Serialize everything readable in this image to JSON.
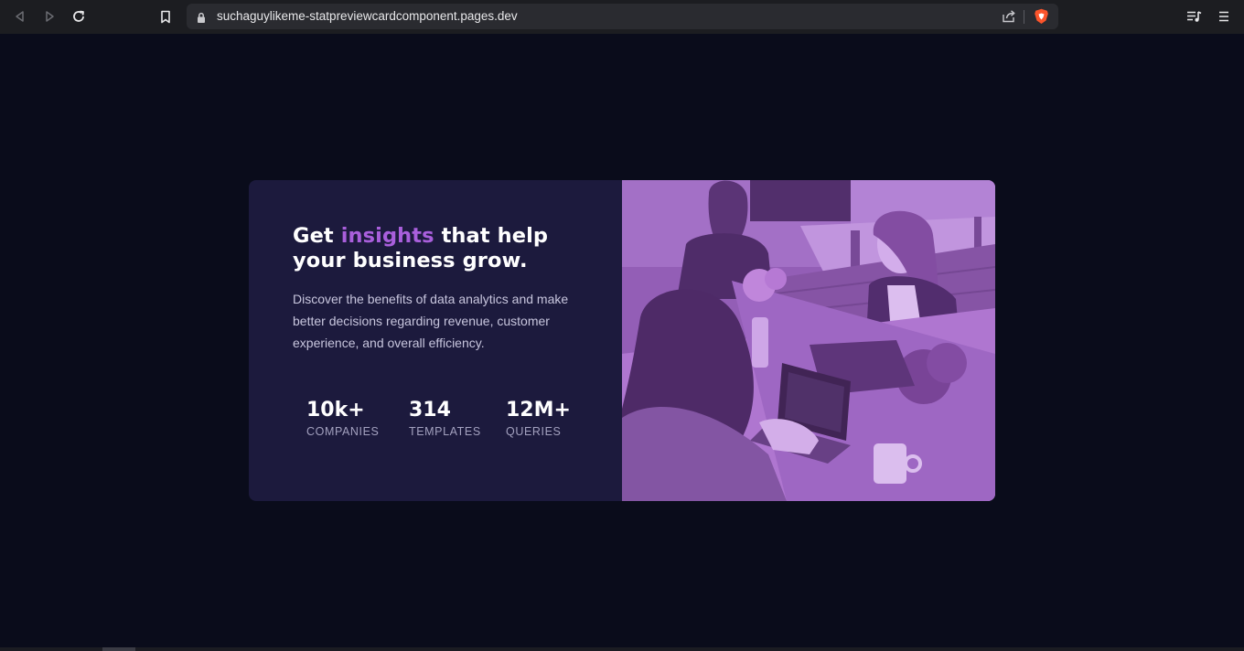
{
  "browser": {
    "url": "suchaguylikeme-statpreviewcardcomponent.pages.dev",
    "icons": {
      "back": "back-arrow-icon",
      "forward": "forward-arrow-icon",
      "reload": "reload-icon",
      "bookmark": "bookmark-icon",
      "lock": "lock-icon",
      "share": "share-icon",
      "brave": "brave-shield-icon",
      "playlist": "playlist-icon",
      "menu": "menu-icon"
    }
  },
  "card": {
    "headline_prefix": "Get ",
    "headline_accent": "insights",
    "headline_suffix": " that help your business grow.",
    "description": "Discover the benefits of data analytics and make better decisions regarding revenue, customer experience, and overall efficiency.",
    "stats": [
      {
        "value": "10k+",
        "label": "COMPANIES"
      },
      {
        "value": "314",
        "label": "TEMPLATES"
      },
      {
        "value": "12M+",
        "label": "QUERIES"
      }
    ],
    "image_alt": "people working on laptops in an office"
  },
  "colors": {
    "page_bg": "#0a0c1b",
    "card_bg": "#1c1a3d",
    "accent": "#a95fdc",
    "image_tint": "#9364b3"
  }
}
